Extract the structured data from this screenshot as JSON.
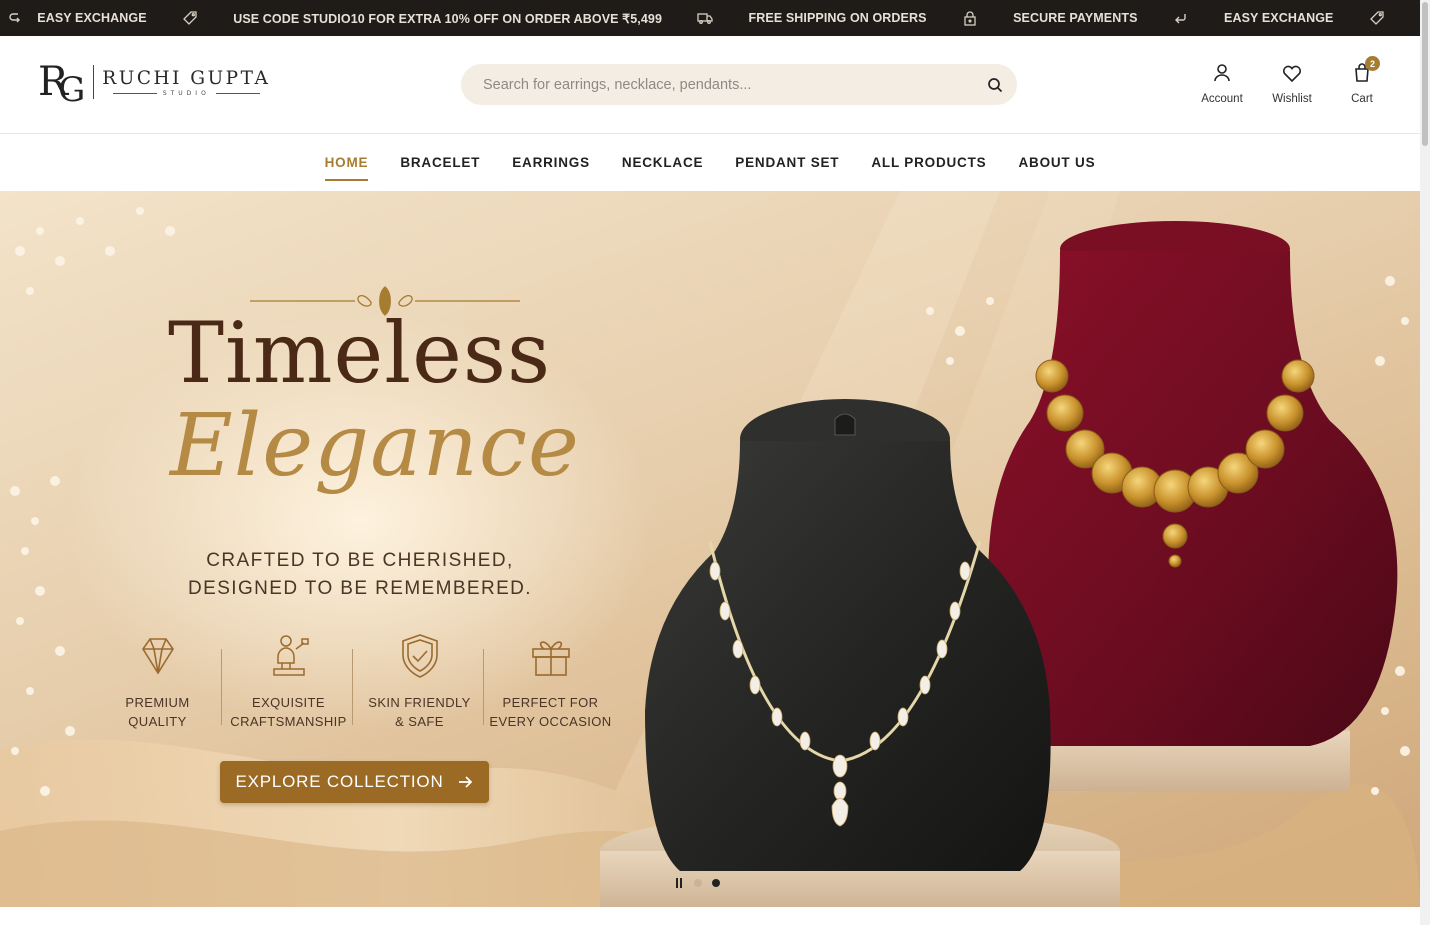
{
  "announcement": {
    "items": [
      {
        "text": "EASY EXCHANGE",
        "icon": "tag-icon"
      },
      {
        "text": "USE CODE STUDIO10 FOR EXTRA 10% OFF ON ORDER ABOVE ₹5,499",
        "icon": "truck-icon"
      },
      {
        "text": "FREE SHIPPING ON ORDERS",
        "icon": "lock-icon"
      },
      {
        "text": "SECURE PAYMENTS",
        "icon": "return-icon"
      },
      {
        "text": "EASY EXCHANGE",
        "icon": "tag-icon"
      }
    ]
  },
  "header": {
    "logo_monogram_1": "R",
    "logo_monogram_2": "G",
    "logo_name": "RUCHI GUPTA",
    "logo_sub": "STUDIO",
    "search_placeholder": "Search for earrings, necklace, pendants...",
    "account_label": "Account",
    "wishlist_label": "Wishlist",
    "cart_label": "Cart",
    "cart_count": "2"
  },
  "nav": {
    "items": [
      "HOME",
      "BRACELET",
      "EARRINGS",
      "NECKLACE",
      "PENDANT SET",
      "ALL PRODUCTS",
      "ABOUT US"
    ],
    "active": "HOME"
  },
  "hero": {
    "title": "Timeless",
    "script_title": "Elegance",
    "tagline_1": "CRAFTED TO BE CHERISHED,",
    "tagline_2": "DESIGNED TO BE REMEMBERED.",
    "features": [
      {
        "label": "PREMIUM\nQUALITY",
        "icon": "diamond-icon"
      },
      {
        "label": "EXQUISITE\nCRAFTSMANSHIP",
        "icon": "artisan-icon"
      },
      {
        "label": "SKIN FRIENDLY\n& SAFE",
        "icon": "shield-check-icon"
      },
      {
        "label": "PERFECT FOR\nEVERY OCCASION",
        "icon": "gift-icon"
      }
    ],
    "cta_label": "EXPLORE COLLECTION",
    "slides_total": 2,
    "active_slide": 2
  },
  "colors": {
    "accent": "#a67c30",
    "topbar": "#1f1b18",
    "cta": "#9b6a24",
    "title": "#4a2a16"
  }
}
